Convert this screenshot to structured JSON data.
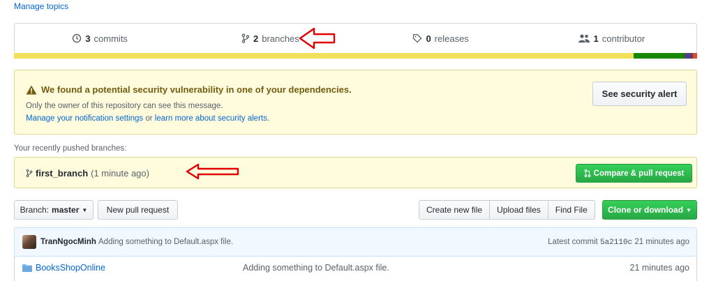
{
  "topics": {
    "manage_label": "Manage topics"
  },
  "summary": {
    "commits_count": "3",
    "commits_label": "commits",
    "branches_count": "2",
    "branches_label": "branches",
    "releases_count": "0",
    "releases_label": "releases",
    "contributors_count": "1",
    "contributors_label": "contributor"
  },
  "languages": [
    {
      "color": "#f1e05a",
      "share": 0.907
    },
    {
      "color": "#178600",
      "share": 0.075
    },
    {
      "color": "#563d7c",
      "share": 0.012
    },
    {
      "color": "#e34c26",
      "share": 0.006
    }
  ],
  "security_alert": {
    "title": "We found a potential security vulnerability in one of your dependencies.",
    "subtitle": "Only the owner of this repository can see this message.",
    "link_settings": "Manage your notification settings",
    "or_text": " or ",
    "link_learn": "learn more about security alerts",
    "period": ".",
    "button": "See security alert"
  },
  "recent": {
    "label": "Your recently pushed branches:",
    "branch": "first_branch",
    "time": "(1 minute ago)",
    "compare_button": "Compare & pull request"
  },
  "toolbar": {
    "branch_prefix": "Branch:",
    "branch_name": "master",
    "new_pr": "New pull request",
    "create_file": "Create new file",
    "upload_files": "Upload files",
    "find_file": "Find File",
    "clone": "Clone or download"
  },
  "commit": {
    "author": "TranNgocMinh",
    "message": "Adding something to Default.aspx file.",
    "latest_label": "Latest commit",
    "sha": "5a2110c",
    "age": "21 minutes ago"
  },
  "files": [
    {
      "name": "BooksShopOnline",
      "message": "Adding something to Default.aspx file.",
      "age": "21 minutes ago"
    }
  ],
  "colors": {
    "accent_red": "#e00000",
    "link": "#0366d6",
    "green": "#28a745",
    "alert_bg": "#fffbdd"
  }
}
